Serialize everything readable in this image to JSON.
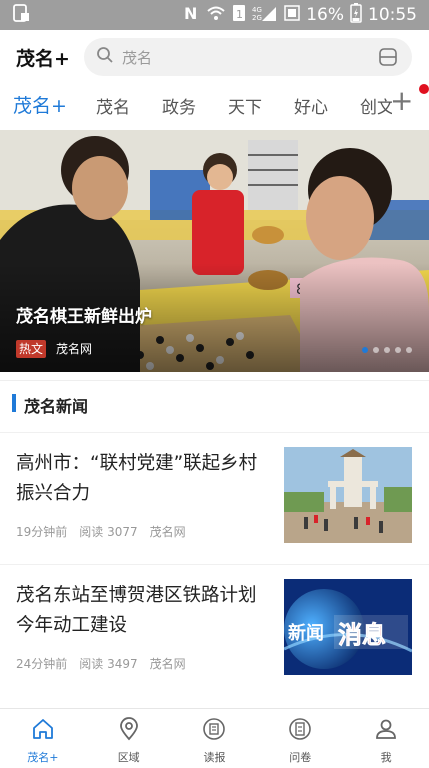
{
  "status_bar": {
    "battery_percent": "16%",
    "time": "10:55",
    "network": "4G"
  },
  "header": {
    "brand": "茂名+",
    "search": {
      "placeholder": "茂名"
    }
  },
  "tabs": [
    {
      "label": "茂名+",
      "active": true
    },
    {
      "label": "茂名",
      "active": false
    },
    {
      "label": "政务",
      "active": false
    },
    {
      "label": "天下",
      "active": false
    },
    {
      "label": "好心",
      "active": false
    },
    {
      "label": "创文",
      "active": false
    }
  ],
  "banner": {
    "title": "茂名棋王新鲜出炉",
    "tag": "热文",
    "source": "茂名网",
    "slide_count": 5,
    "active_slide": 1,
    "sign_text": "8"
  },
  "section": {
    "title": "茂名新闻"
  },
  "news": [
    {
      "headline": "高州市：“联村党建”联起乡村振兴合力",
      "time": "19分钟前",
      "reads": "阅读 3077",
      "source": "茂名网"
    },
    {
      "headline": "茂名东站至博贺港区铁路计划今年动工建设",
      "time": "24分钟前",
      "reads": "阅读 3497",
      "source": "茂名网",
      "thumb_text_1": "新闻",
      "thumb_text_2": "消息"
    }
  ],
  "bottom_nav": [
    {
      "label": "茂名+",
      "icon": "home-icon",
      "active": true
    },
    {
      "label": "区域",
      "icon": "location-pin-icon",
      "active": false
    },
    {
      "label": "读报",
      "icon": "newspaper-icon",
      "active": false
    },
    {
      "label": "问卷",
      "icon": "survey-icon",
      "active": false
    },
    {
      "label": "我",
      "icon": "user-icon",
      "active": false
    }
  ],
  "colors": {
    "accent": "#1f7ad8",
    "status_bar": "#9e9e9e",
    "tag_red": "#c0392b",
    "notification_dot": "#e0101f"
  }
}
